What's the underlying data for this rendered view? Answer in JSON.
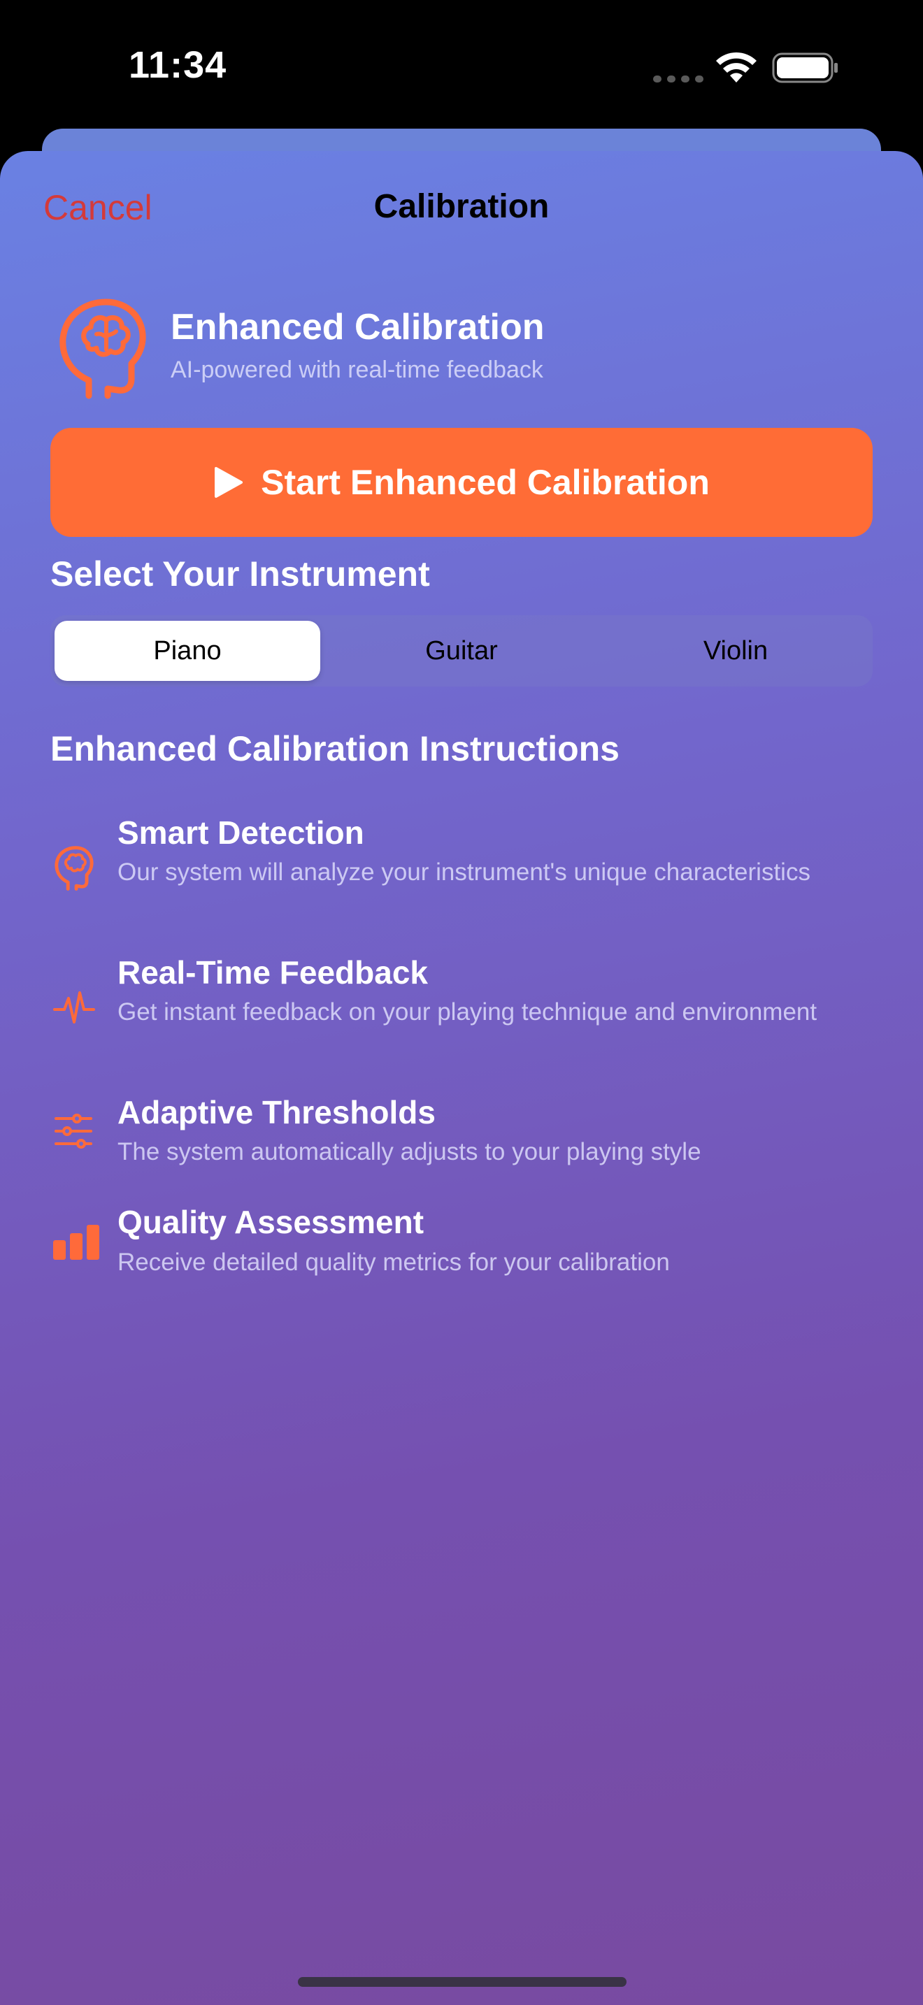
{
  "status_bar": {
    "time": "11:34"
  },
  "nav": {
    "cancel_label": "Cancel",
    "title": "Calibration"
  },
  "hero": {
    "icon": "brain-head-icon",
    "title": "Enhanced Calibration",
    "subtitle": "AI-powered with real-time feedback"
  },
  "start_button": {
    "icon": "play-icon",
    "label": "Start Enhanced Calibration"
  },
  "instrument": {
    "heading": "Select Your Instrument",
    "options": [
      "Piano",
      "Guitar",
      "Violin"
    ],
    "selected": "Piano"
  },
  "instructions": {
    "heading": "Enhanced Calibration Instructions",
    "items": [
      {
        "icon": "brain-head-icon",
        "title": "Smart Detection",
        "description": "Our system will analyze your instrument's unique characteristics"
      },
      {
        "icon": "waveform-icon",
        "title": "Real-Time Feedback",
        "description": "Get instant feedback on your playing technique and environment"
      },
      {
        "icon": "sliders-icon",
        "title": "Adaptive Thresholds",
        "description": "The system automatically adjusts to your playing style"
      },
      {
        "icon": "bar-chart-icon",
        "title": "Quality Assessment",
        "description": "Receive detailed quality metrics for your calibration"
      }
    ]
  },
  "colors": {
    "accent": "#ff6c36",
    "cancel": "#d43a3a",
    "icon": "#ff6a3a"
  }
}
